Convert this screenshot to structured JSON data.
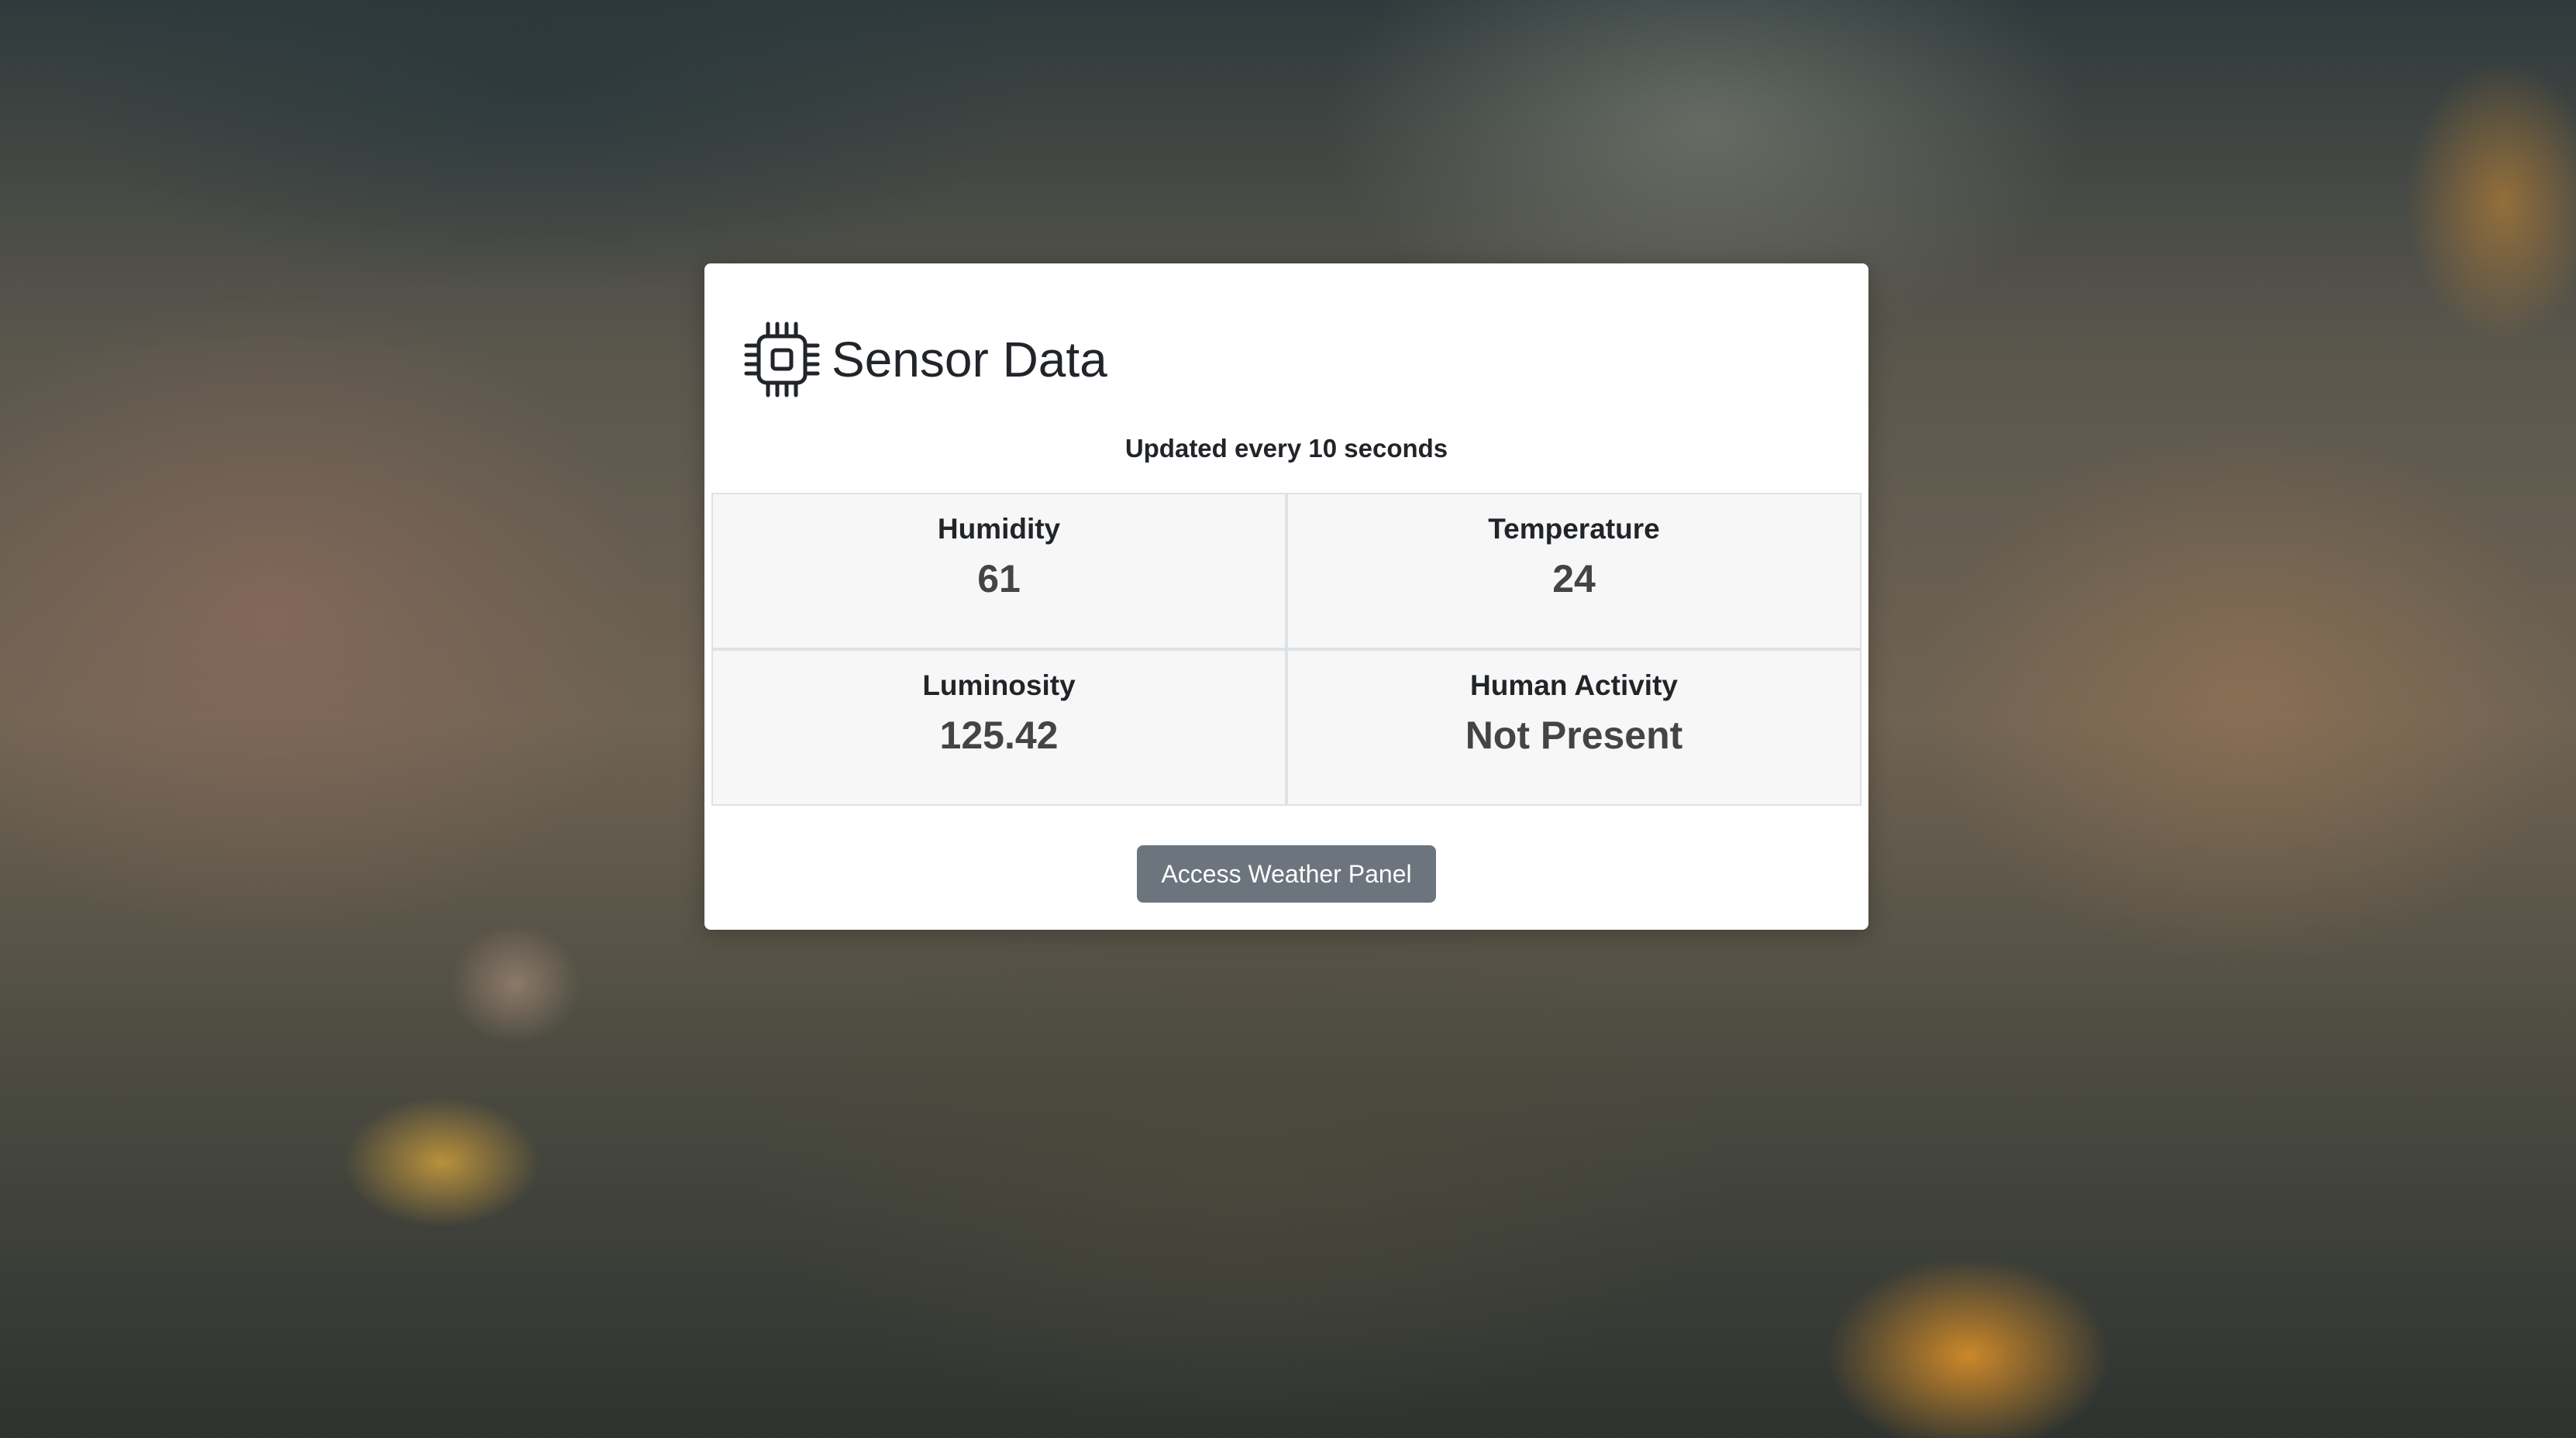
{
  "card": {
    "title": "Sensor Data",
    "icon": "cpu-chip-icon",
    "subtitle": "Updated every 10 seconds"
  },
  "sensors": [
    {
      "label": "Humidity",
      "value": "61"
    },
    {
      "label": "Temperature",
      "value": "24"
    },
    {
      "label": "Luminosity",
      "value": "125.42"
    },
    {
      "label": "Human Activity",
      "value": "Not Present"
    }
  ],
  "actions": {
    "weather_button": "Access Weather Panel"
  },
  "colors": {
    "button_bg": "#6c757d",
    "card_bg": "#ffffff",
    "cell_bg": "#f7f7f7",
    "text": "#212529"
  }
}
